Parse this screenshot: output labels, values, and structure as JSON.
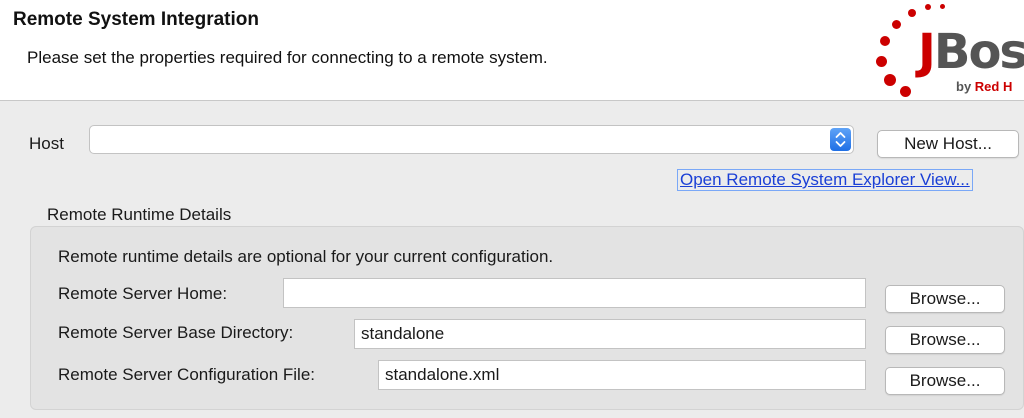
{
  "header": {
    "title": "Remote System Integration",
    "description": "Please set the properties required for connecting to a remote system.",
    "logo": {
      "word_j": "J",
      "word_rest": "Boss",
      "sub_prefix": "by ",
      "sub_brand": "Red H"
    }
  },
  "host": {
    "label": "Host",
    "value": "",
    "new_host_label": "New Host...",
    "explorer_link": "Open Remote System Explorer View..."
  },
  "runtime": {
    "group_title": "Remote Runtime Details",
    "note": "Remote runtime details are optional for your current configuration.",
    "fields": [
      {
        "label": "Remote Server Home:",
        "value": "",
        "browse": "Browse..."
      },
      {
        "label": "Remote Server Base Directory:",
        "value": "standalone",
        "browse": "Browse..."
      },
      {
        "label": "Remote Server Configuration File:",
        "value": "standalone.xml",
        "browse": "Browse..."
      }
    ]
  },
  "colors": {
    "accent": "#1f6fe5",
    "link": "#1a3fd6",
    "brand_red": "#cc0000"
  }
}
